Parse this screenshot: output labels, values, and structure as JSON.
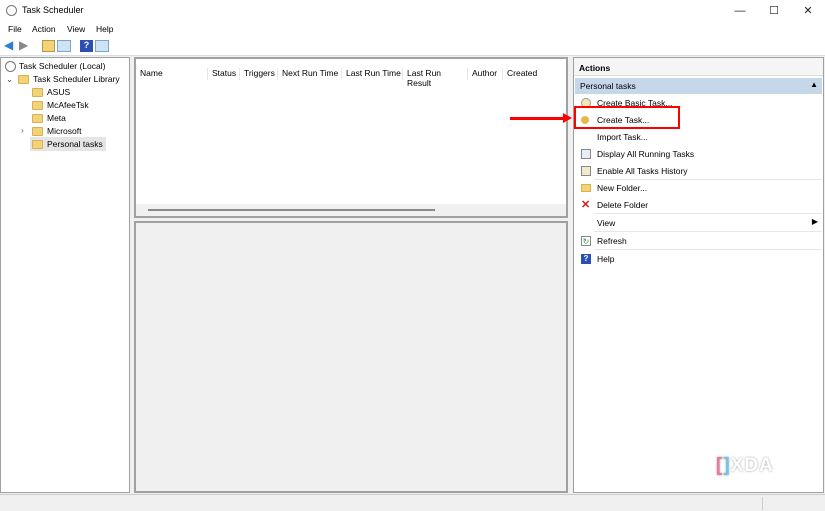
{
  "window": {
    "title": "Task Scheduler",
    "min": "—",
    "max": "☐",
    "close": "✕"
  },
  "menu": [
    "File",
    "Action",
    "View",
    "Help"
  ],
  "tree": {
    "root": "Task Scheduler (Local)",
    "library": "Task Scheduler Library",
    "folders": [
      "ASUS",
      "McAfeeTsk",
      "Meta",
      "Microsoft",
      "Personal tasks"
    ],
    "selected": "Personal tasks"
  },
  "columns": [
    "Name",
    "Status",
    "Triggers",
    "Next Run Time",
    "Last Run Time",
    "Last Run Result",
    "Author",
    "Created"
  ],
  "actions": {
    "header": "Actions",
    "section": "Personal tasks",
    "items": [
      {
        "label": "Create Basic Task...",
        "icon": "wizard-icon"
      },
      {
        "label": "Create Task...",
        "icon": "task-icon"
      },
      {
        "label": "Import Task...",
        "icon": ""
      },
      {
        "label": "Display All Running Tasks",
        "icon": "running-tasks-icon"
      },
      {
        "label": "Enable All Tasks History",
        "icon": "history-icon"
      },
      {
        "label": "New Folder...",
        "icon": "new-folder-icon"
      },
      {
        "label": "Delete Folder",
        "icon": "delete-icon"
      },
      {
        "label": "View",
        "icon": ""
      },
      {
        "label": "Refresh",
        "icon": "refresh-icon"
      },
      {
        "label": "Help",
        "icon": "help-icon"
      }
    ]
  },
  "watermark": "XDA",
  "colors": {
    "highlight": "#ff0000",
    "section": "#c7d7ea"
  }
}
